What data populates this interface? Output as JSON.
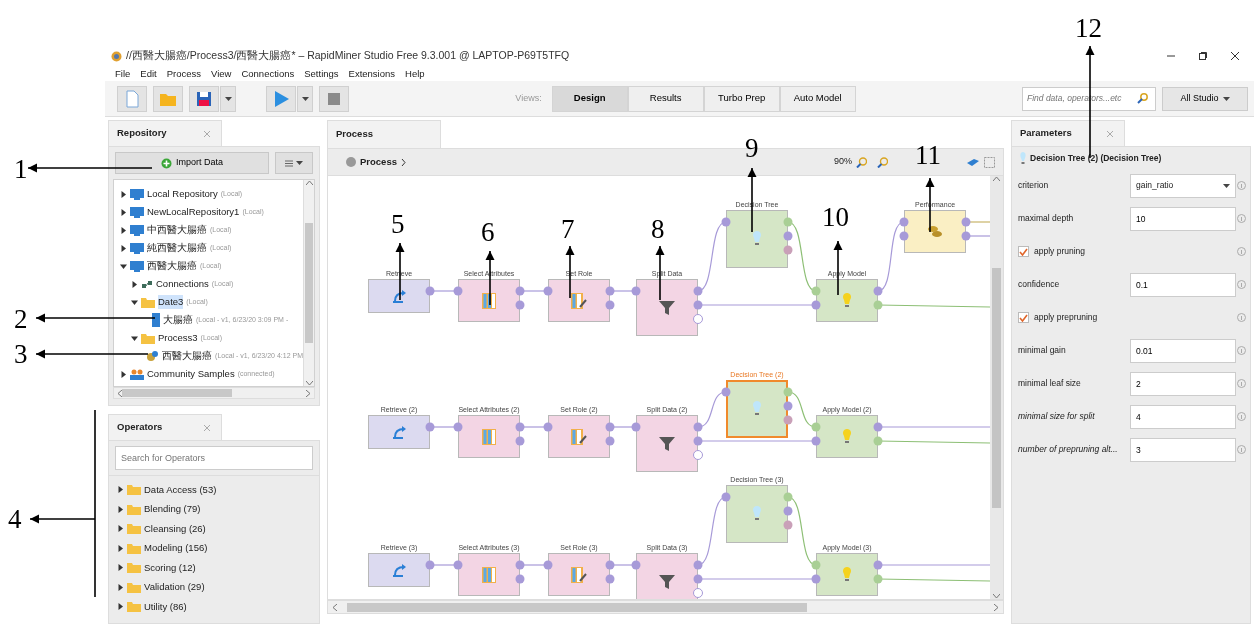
{
  "window": {
    "title": "//西醫大腸癌/Process3/西醫大腸癌* – RapidMiner Studio Free 9.3.001 @ LAPTOP-P69T5TFQ"
  },
  "menu": [
    "File",
    "Edit",
    "Process",
    "View",
    "Connections",
    "Settings",
    "Extensions",
    "Help"
  ],
  "toolbar": {
    "views_label": "Views:",
    "views": [
      {
        "label": "Design",
        "selected": true
      },
      {
        "label": "Results",
        "selected": false
      },
      {
        "label": "Turbo Prep",
        "selected": false
      },
      {
        "label": "Auto Model",
        "selected": false
      }
    ],
    "search": {
      "placeholder": "Find data, operators...etc"
    },
    "scope": "All Studio"
  },
  "repository": {
    "title": "Repository",
    "import_button": "Import Data",
    "tree": [
      {
        "label": "Local Repository",
        "note": "(Local)",
        "kind": "repository",
        "expanded": false,
        "selected": false
      },
      {
        "label": "NewLocalRepository1",
        "note": "(Local)",
        "kind": "repository",
        "expanded": false,
        "selected": false
      },
      {
        "label": "中西醫大腸癌",
        "note": "(Local)",
        "kind": "repository",
        "expanded": false,
        "selected": false
      },
      {
        "label": "純西醫大腸癌",
        "note": "(Local)",
        "kind": "repository",
        "expanded": false,
        "selected": false
      },
      {
        "label": "西醫大腸癌",
        "note": "(Local)",
        "kind": "repository",
        "expanded": true,
        "selected": false,
        "children": [
          {
            "label": "Connections",
            "note": "(Local)",
            "kind": "connections",
            "expanded": false,
            "selected": false
          },
          {
            "label": "Date3",
            "note": "(Local)",
            "kind": "folder",
            "expanded": true,
            "selected": true,
            "children": [
              {
                "label": "大腸癌",
                "note": "(Local - v1, 6/23/20 3:09 PM -",
                "kind": "data",
                "selected": false
              }
            ]
          },
          {
            "label": "Process3",
            "note": "(Local)",
            "kind": "folder",
            "expanded": true,
            "selected": false,
            "children": [
              {
                "label": "西醫大腸癌",
                "note": "(Local - v1, 6/23/20 4:12 PM",
                "kind": "process",
                "selected": false
              }
            ]
          }
        ]
      },
      {
        "label": "Community Samples",
        "note": "(connected)",
        "kind": "community",
        "expanded": false,
        "selected": false
      }
    ]
  },
  "operators": {
    "title": "Operators",
    "search": {
      "placeholder": "Search for Operators"
    },
    "groups": [
      {
        "label": "Data Access (53)",
        "expanded": false
      },
      {
        "label": "Blending (79)",
        "expanded": false
      },
      {
        "label": "Cleansing (26)",
        "expanded": false
      },
      {
        "label": "Modeling (156)",
        "expanded": false
      },
      {
        "label": "Scoring (12)",
        "expanded": false
      },
      {
        "label": "Validation (29)",
        "expanded": false
      },
      {
        "label": "Utility (86)",
        "expanded": false
      }
    ]
  },
  "process": {
    "tab": "Process",
    "breadcrumb": "Process",
    "zoom": "90%",
    "nodes": [
      {
        "label": "Retrieve",
        "kind": "retrieve",
        "selected": false
      },
      {
        "label": "Select Attributes",
        "kind": "select",
        "selected": false
      },
      {
        "label": "Set Role",
        "kind": "role",
        "selected": false
      },
      {
        "label": "Split Data",
        "kind": "split",
        "selected": false
      },
      {
        "label": "Decision Tree",
        "kind": "tree",
        "selected": false
      },
      {
        "label": "Apply Model",
        "kind": "apply",
        "selected": false
      },
      {
        "label": "Performance",
        "kind": "performance",
        "selected": false
      },
      {
        "label": "Retrieve (2)",
        "kind": "retrieve",
        "selected": false
      },
      {
        "label": "Select Attributes (2)",
        "kind": "select",
        "selected": false
      },
      {
        "label": "Set Role (2)",
        "kind": "role",
        "selected": false
      },
      {
        "label": "Split Data (2)",
        "kind": "split",
        "selected": false
      },
      {
        "label": "Decision Tree (2)",
        "kind": "tree",
        "selected": true
      },
      {
        "label": "Apply Model (2)",
        "kind": "apply",
        "selected": false
      },
      {
        "label": "Decision Tree (3)",
        "kind": "tree",
        "selected": false
      },
      {
        "label": "Retrieve (3)",
        "kind": "retrieve",
        "selected": false
      },
      {
        "label": "Select Attributes (3)",
        "kind": "select",
        "selected": false
      },
      {
        "label": "Set Role (3)",
        "kind": "role",
        "selected": false
      },
      {
        "label": "Split Data (3)",
        "kind": "split",
        "selected": false
      },
      {
        "label": "Apply Model (3)",
        "kind": "apply",
        "selected": false
      }
    ]
  },
  "parameters": {
    "title": "Parameters",
    "operator": "Decision Tree (2) (Decision Tree)",
    "rows": [
      {
        "label": "criterion",
        "kind": "select",
        "value": "gain_ratio",
        "expert": false
      },
      {
        "label": "maximal depth",
        "kind": "text",
        "value": "10",
        "expert": false
      },
      {
        "label": "apply pruning",
        "kind": "checkbox",
        "checked": true,
        "expert": false
      },
      {
        "label": "confidence",
        "kind": "text",
        "value": "0.1",
        "expert": false
      },
      {
        "label": "apply prepruning",
        "kind": "checkbox",
        "checked": true,
        "expert": false
      },
      {
        "label": "minimal gain",
        "kind": "text",
        "value": "0.01",
        "expert": false
      },
      {
        "label": "minimal leaf size",
        "kind": "text",
        "value": "2",
        "expert": false
      },
      {
        "label": "minimal size for split",
        "kind": "text",
        "value": "4",
        "expert": true
      },
      {
        "label": "number of prepruning alt...",
        "kind": "text",
        "value": "3",
        "expert": true
      }
    ]
  },
  "annotations": [
    {
      "label": "1"
    },
    {
      "label": "2"
    },
    {
      "label": "3"
    },
    {
      "label": "4"
    },
    {
      "label": "5"
    },
    {
      "label": "6"
    },
    {
      "label": "7"
    },
    {
      "label": "8"
    },
    {
      "label": "9"
    },
    {
      "label": "10"
    },
    {
      "label": "11"
    },
    {
      "label": "12"
    }
  ]
}
